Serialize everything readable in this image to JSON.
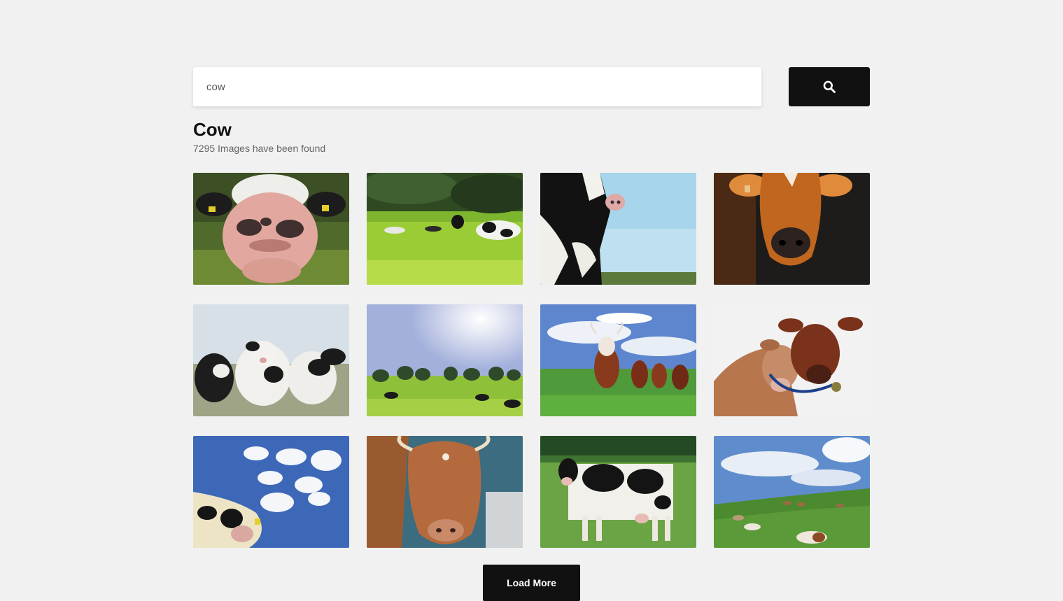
{
  "search": {
    "value": "cow",
    "placeholder": ""
  },
  "results": {
    "title": "Cow",
    "count_text": "7295 Images have been found"
  },
  "images": [
    {
      "subject": "close-up pink cow nose"
    },
    {
      "subject": "cow lying in green field"
    },
    {
      "subject": "holstein cow against sky"
    },
    {
      "subject": "brown jersey calf portrait"
    },
    {
      "subject": "holstein calves in field"
    },
    {
      "subject": "cows grazing under sun"
    },
    {
      "subject": "horned cows on pasture"
    },
    {
      "subject": "two brown cows cuddling"
    },
    {
      "subject": "cow under cloudy blue sky"
    },
    {
      "subject": "brown horned cow portrait"
    },
    {
      "subject": "holstein cow standing on grass"
    },
    {
      "subject": "cows resting on hillside"
    }
  ],
  "load_more": {
    "label": "Load More"
  }
}
